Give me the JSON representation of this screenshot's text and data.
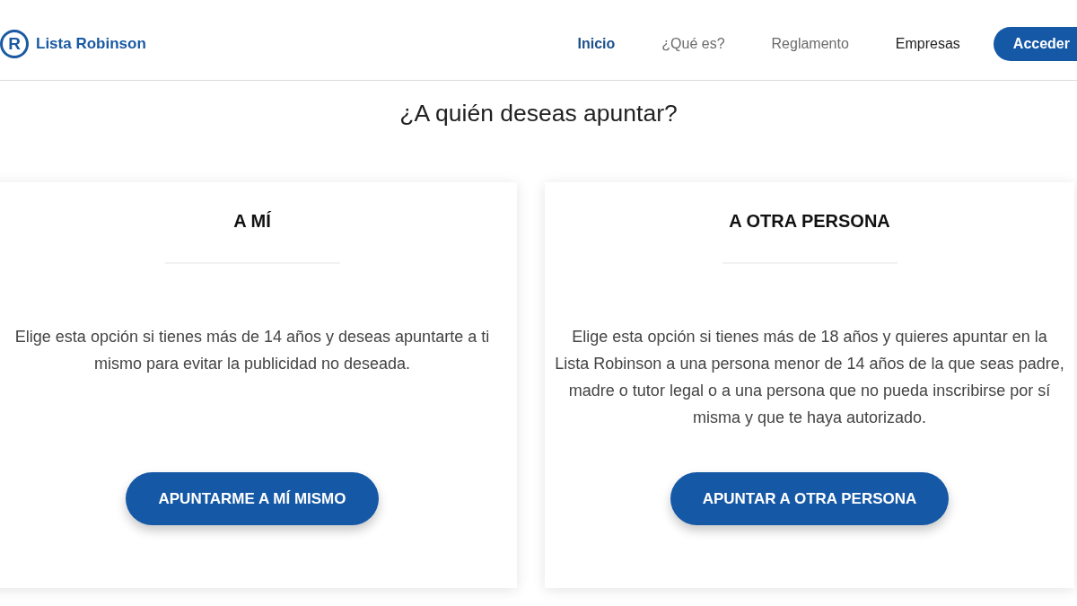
{
  "header": {
    "logo": {
      "mark": "R",
      "name": "Lista Robinson"
    },
    "nav": [
      {
        "label": "Inicio",
        "selected": true,
        "hovered": false
      },
      {
        "label": "¿Qué es?",
        "selected": false,
        "hovered": false
      },
      {
        "label": "Reglamento",
        "selected": false,
        "hovered": false
      },
      {
        "label": "Empresas",
        "selected": false,
        "hovered": true
      }
    ],
    "login_button": "Acceder"
  },
  "heading": "¿A quién deseas apuntar?",
  "options": [
    {
      "title": "A MÍ",
      "description": "Elige esta opción si tienes más de 14 años y deseas apuntarte a ti mismo para evitar la publicidad no deseada.",
      "button": "APUNTARME A MÍ MISMO"
    },
    {
      "title": "A OTRA PERSONA",
      "description": "Elige esta opción si tienes más de 18 años y quieres apuntar en la Lista Robinson a una persona menor de 14 años de la que seas padre, madre o tutor legal o a una persona que no pueda inscribirse por sí misma y que te haya autorizado.",
      "button": "APUNTAR A OTRA PERSONA"
    }
  ]
}
